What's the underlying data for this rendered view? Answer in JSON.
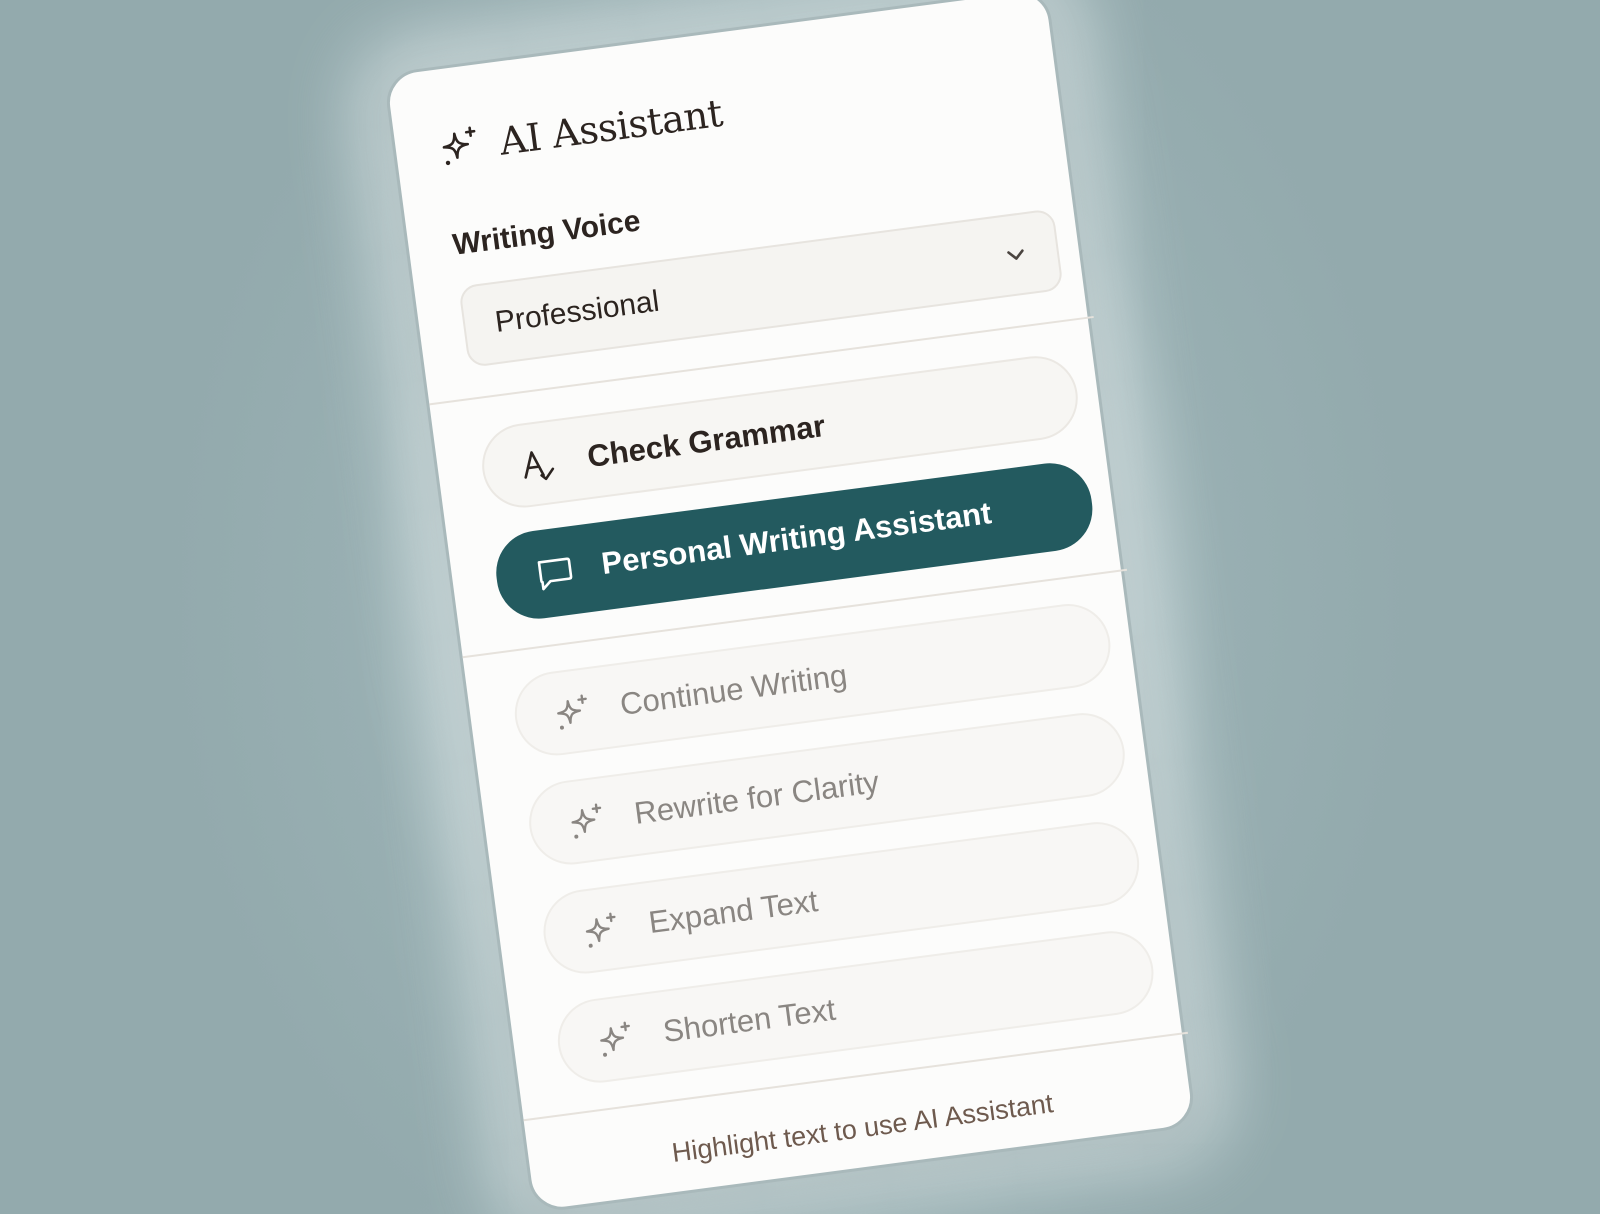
{
  "panel": {
    "title": "AI Assistant",
    "title_icon": "sparkles-icon"
  },
  "voice": {
    "label": "Writing Voice",
    "selected": "Professional"
  },
  "actions": [
    {
      "label": "Check Grammar",
      "icon": "spellcheck-icon",
      "state": "default"
    },
    {
      "label": "Personal Writing Assistant",
      "icon": "chat-bubble-icon",
      "state": "active"
    },
    {
      "label": "Continue Writing",
      "icon": "sparkles-icon",
      "state": "disabled"
    },
    {
      "label": "Rewrite for Clarity",
      "icon": "sparkles-icon",
      "state": "disabled"
    },
    {
      "label": "Expand Text",
      "icon": "sparkles-icon",
      "state": "disabled"
    },
    {
      "label": "Shorten Text",
      "icon": "sparkles-icon",
      "state": "disabled"
    }
  ],
  "footer": {
    "hint": "Highlight text to use AI Assistant"
  },
  "colors": {
    "accent": "#235a5f",
    "background": "#98afb2",
    "panel": "#fcfcfb",
    "text": "#2c2420",
    "muted_text": "#8a8682"
  }
}
